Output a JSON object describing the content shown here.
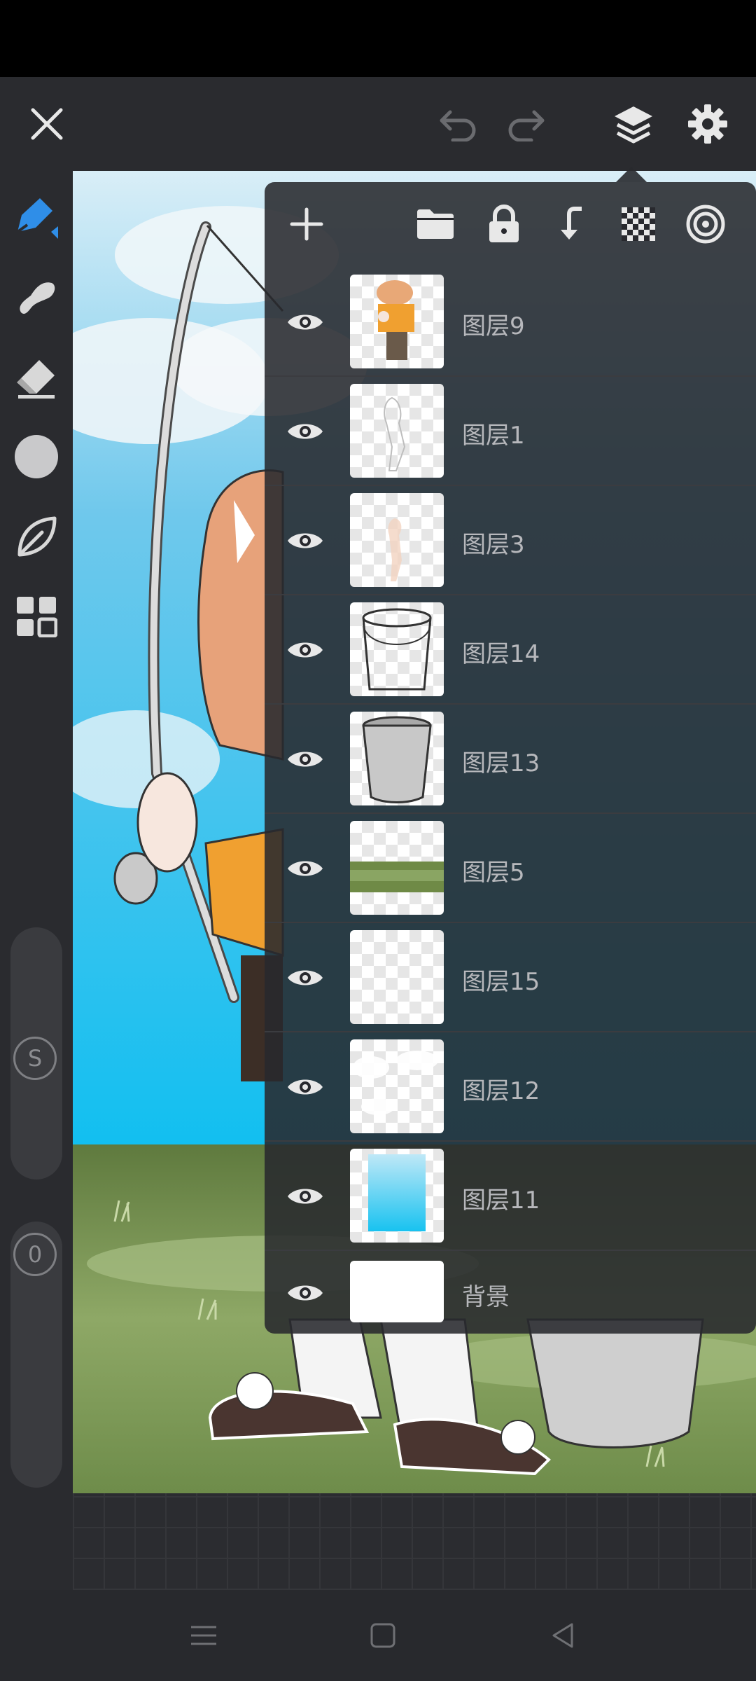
{
  "topbar": {
    "close_icon": "close-icon",
    "undo_icon": "undo-icon",
    "redo_icon": "redo-icon",
    "layers_icon": "layers-icon",
    "settings_icon": "gear-icon"
  },
  "tools": [
    "pen-icon",
    "smudge-icon",
    "eraser-icon",
    "color-icon",
    "leaf-icon",
    "grid-icon"
  ],
  "sliders": {
    "size_label": "S",
    "opacity_label": "0"
  },
  "layers_panel": {
    "toolbar": [
      "plus-icon",
      "folder-icon",
      "lock-icon",
      "merge-down-icon",
      "checker-icon",
      "target-icon"
    ],
    "layers": [
      {
        "name": "图层9"
      },
      {
        "name": "图层1"
      },
      {
        "name": "图层3"
      },
      {
        "name": "图层14"
      },
      {
        "name": "图层13"
      },
      {
        "name": "图层5"
      },
      {
        "name": "图层15"
      },
      {
        "name": "图层12"
      },
      {
        "name": "图层11"
      },
      {
        "name": "背景"
      }
    ]
  },
  "colors": {
    "accent": "#2f8ee8",
    "panel": "#28292e",
    "text": "#b7b8bc"
  },
  "nav": [
    "menu-icon",
    "home-icon",
    "back-icon"
  ]
}
